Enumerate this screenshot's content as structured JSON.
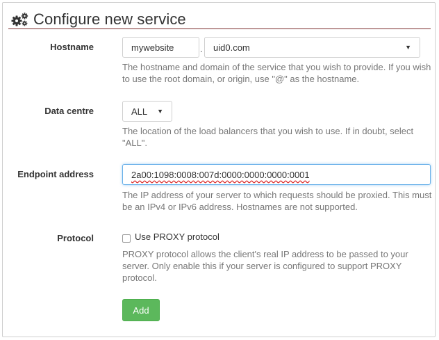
{
  "form": {
    "title": "Configure new service",
    "title_icon": "cogs-icon",
    "hostname": {
      "label": "Hostname",
      "value": "mywebsite",
      "separator": ".",
      "domain": "uid0.com",
      "help": "The hostname and domain of the service that you wish to provide. If you wish to use the root domain, or origin, use \"@\" as the hostname."
    },
    "datacentre": {
      "label": "Data centre",
      "value": "ALL",
      "help": "The location of the load balancers that you wish to use. If in doubt, select \"ALL\"."
    },
    "endpoint": {
      "label": "Endpoint address",
      "value": "2a00:1098:0008:007d:0000:0000:0000:0001",
      "help": "The IP address of your server to which requests should be proxied. This must be an IPv4 or IPv6 address. Hostnames are not supported."
    },
    "protocol": {
      "label": "Protocol",
      "checkbox_label": "Use PROXY protocol",
      "checked": false,
      "help": "PROXY protocol allows the client's real IP address to be passed to your server. Only enable this if your server is configured to support PROXY protocol."
    },
    "submit_label": "Add"
  },
  "colors": {
    "accent_rule": "#7a2a2a",
    "button_bg": "#5cb85c",
    "focus_border": "#66afe9"
  }
}
